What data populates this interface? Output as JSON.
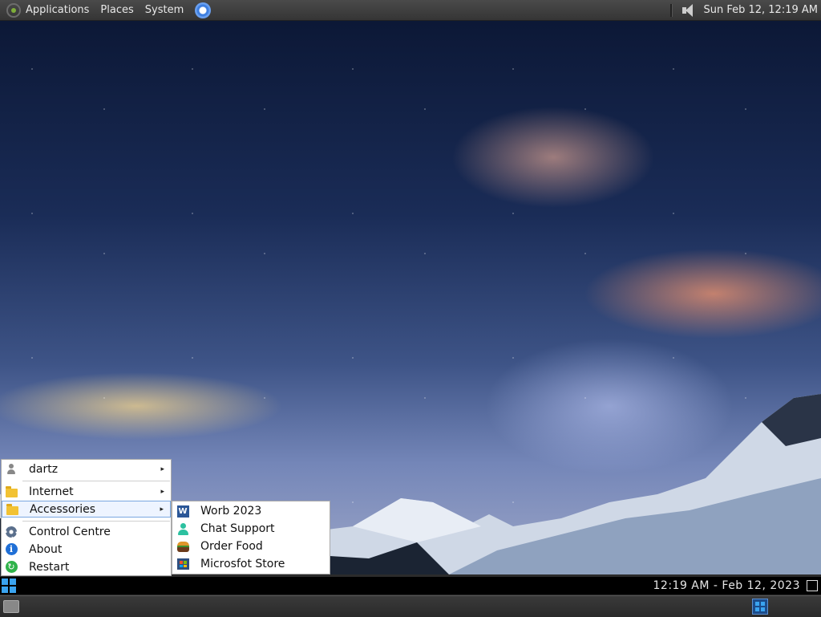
{
  "top_panel": {
    "menus": [
      "Applications",
      "Places",
      "System"
    ],
    "icons": [
      "distro-logo-icon",
      "chrome-browser-icon",
      "speaker-volume-icon"
    ],
    "clock": "Sun Feb 12, 12:19 AM"
  },
  "start_menu": {
    "items": [
      {
        "label": "dartz",
        "icon": "user-icon",
        "has_submenu": true
      },
      {
        "label": "Internet",
        "icon": "folder-icon",
        "has_submenu": true
      },
      {
        "label": "Accessories",
        "icon": "folder-icon",
        "has_submenu": true,
        "highlighted": true
      },
      {
        "label": "Control Centre",
        "icon": "gear-icon",
        "has_submenu": false
      },
      {
        "label": "About",
        "icon": "info-icon",
        "has_submenu": false
      },
      {
        "label": "Restart",
        "icon": "restart-icon",
        "has_submenu": false
      }
    ],
    "arrow": "▸"
  },
  "accessories_submenu": {
    "items": [
      {
        "label": "Worb 2023",
        "icon": "word-icon"
      },
      {
        "label": "Chat Support",
        "icon": "chat-support-icon"
      },
      {
        "label": "Order Food",
        "icon": "burger-icon"
      },
      {
        "label": "Microsfot Store",
        "icon": "store-icon"
      }
    ]
  },
  "bottom_bar": {
    "clock": "12:19 AM - Feb 12, 2023",
    "icons": [
      "start-windows-icon",
      "show-desktop-icon"
    ]
  },
  "bottom_panel": {
    "icons": [
      "desktop-icon",
      "windows-app-icon"
    ]
  },
  "colors": {
    "panel": "#3a3a3a",
    "taskbar": "#000000",
    "accent": "#3aa4f0",
    "highlight_border": "#7aa7e0"
  }
}
